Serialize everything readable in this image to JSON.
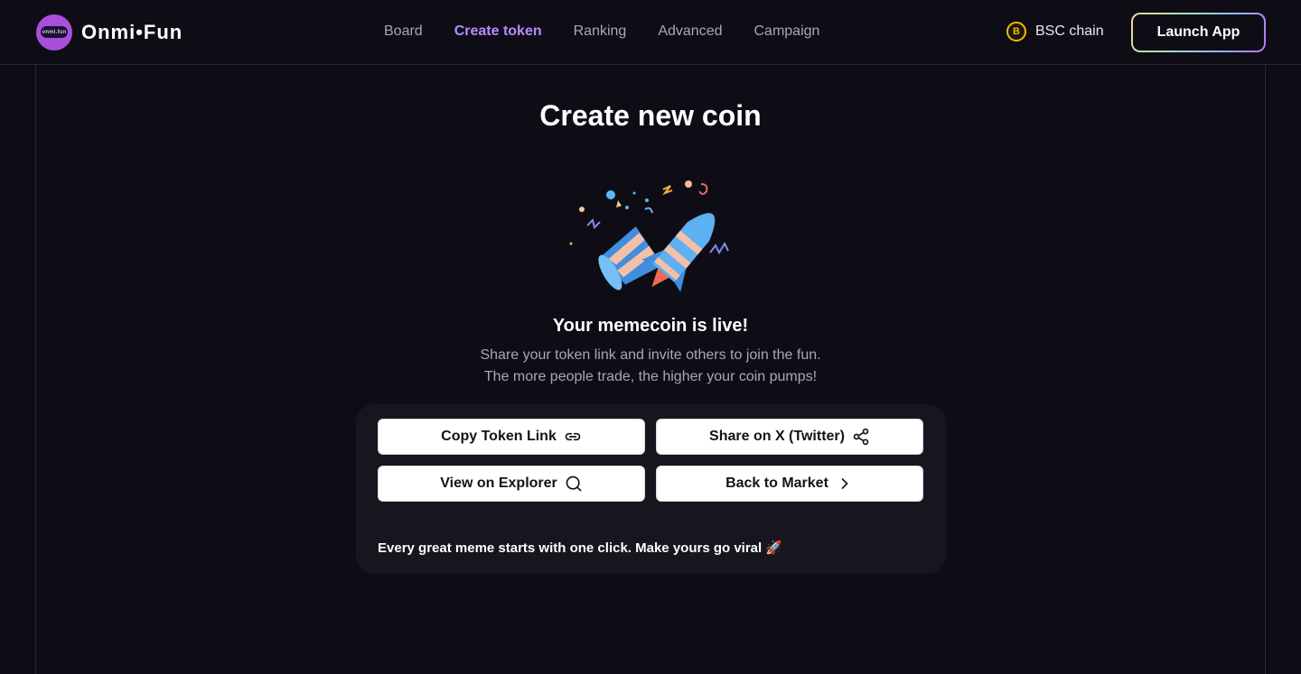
{
  "header": {
    "logo_text": "Onmi•Fun",
    "logo_badge": "onmi.fun",
    "nav": [
      {
        "label": "Board",
        "active": false
      },
      {
        "label": "Create token",
        "active": true
      },
      {
        "label": "Ranking",
        "active": false
      },
      {
        "label": "Advanced",
        "active": false
      },
      {
        "label": "Campaign",
        "active": false
      }
    ],
    "chain_label": "BSC chain",
    "chain_icon": "bitcoin-icon",
    "launch_label": "Launch App"
  },
  "main": {
    "title": "Create new coin",
    "live_title": "Your memecoin is live!",
    "subtext_line1": "Share your token link and invite others to join the fun.",
    "subtext_line2": "The more people trade, the higher your coin pumps!"
  },
  "actions": {
    "copy_link": "Copy Token Link",
    "share_x": "Share on X (Twitter)",
    "explorer": "View on Explorer",
    "back_market": "Back to Market",
    "tagline": "Every great meme starts with one click. Make yours go viral 🚀"
  },
  "colors": {
    "accent": "#b88cff",
    "background": "#0e0d16",
    "card": "#17161e",
    "chain": "#f0b90b"
  }
}
